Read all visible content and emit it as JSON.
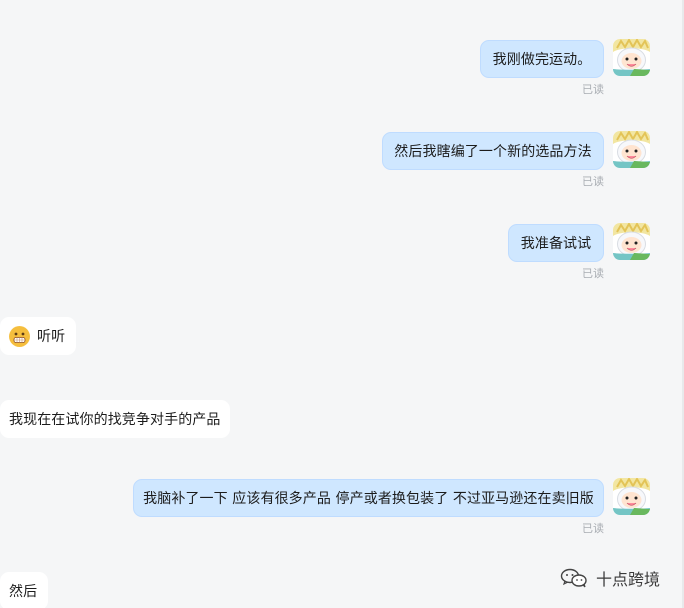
{
  "messages": [
    {
      "side": "out",
      "text": "我刚做完运动。",
      "read": "已读"
    },
    {
      "side": "out",
      "text": "然后我瞎编了一个新的选品方法",
      "read": "已读"
    },
    {
      "side": "out",
      "text": "我准备试试",
      "read": "已读"
    },
    {
      "side": "in",
      "text": "听听",
      "emoji": "grinning-face-emoji"
    },
    {
      "side": "in",
      "text": "我现在在试你的找竞争对手的产品"
    },
    {
      "side": "out",
      "text": "我脑补了一下 应该有很多产品 停产或者换包装了 不过亚马逊还在卖旧版",
      "read": "已读"
    },
    {
      "side": "in",
      "text": "然后"
    }
  ],
  "watermark": {
    "text": "十点跨境",
    "icon": "wechat-icon"
  },
  "colors": {
    "outgoing_bubble": "#cfe7ff",
    "incoming_bubble": "#ffffff",
    "background": "#f5f6f7",
    "read_text": "#a9adb3"
  }
}
